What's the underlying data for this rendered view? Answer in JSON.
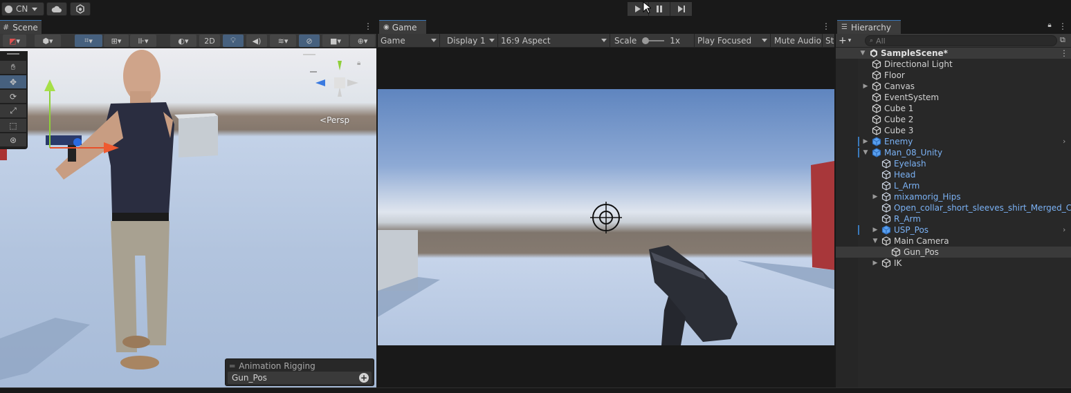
{
  "topbar": {
    "account_label": "CN",
    "play_icons": [
      "play-icon",
      "pause-icon",
      "step-icon"
    ]
  },
  "scene": {
    "tab_label": "Scene",
    "toolbar_2d": "2D",
    "persp_label": "Persp",
    "overlay_title": "Animation Rigging",
    "overlay_field": "Gun_Pos"
  },
  "game": {
    "tab_label": "Game",
    "mode": "Game",
    "display": "Display 1",
    "aspect": "16:9 Aspect",
    "scale_label": "Scale",
    "scale_value": "1x",
    "play_focused": "Play Focused",
    "mute": "Mute Audio",
    "stats": "St"
  },
  "hierarchy": {
    "tab_label": "Hierarchy",
    "search_placeholder": "All",
    "scene_name": "SampleScene*",
    "items": [
      {
        "label": "Directional Light"
      },
      {
        "label": "Floor"
      },
      {
        "label": "Canvas"
      },
      {
        "label": "EventSystem"
      },
      {
        "label": "Cube 1"
      },
      {
        "label": "Cube 2"
      },
      {
        "label": "Cube 3"
      },
      {
        "label": "Enemy"
      },
      {
        "label": "Man_08_Unity"
      },
      {
        "label": "Eyelash"
      },
      {
        "label": "Head"
      },
      {
        "label": "L_Arm"
      },
      {
        "label": "mixamorig_Hips"
      },
      {
        "label": "Open_collar_short_sleeves_shirt_Merged_Clo"
      },
      {
        "label": "R_Arm"
      },
      {
        "label": "USP_Pos"
      },
      {
        "label": "Main Camera"
      },
      {
        "label": "Gun_Pos"
      },
      {
        "label": "IK"
      }
    ]
  },
  "colors": {
    "accent": "#3a79bb",
    "prefab_text": "#7bb2f5",
    "panel_bg": "#282828",
    "toolbar_bg": "#383838"
  }
}
